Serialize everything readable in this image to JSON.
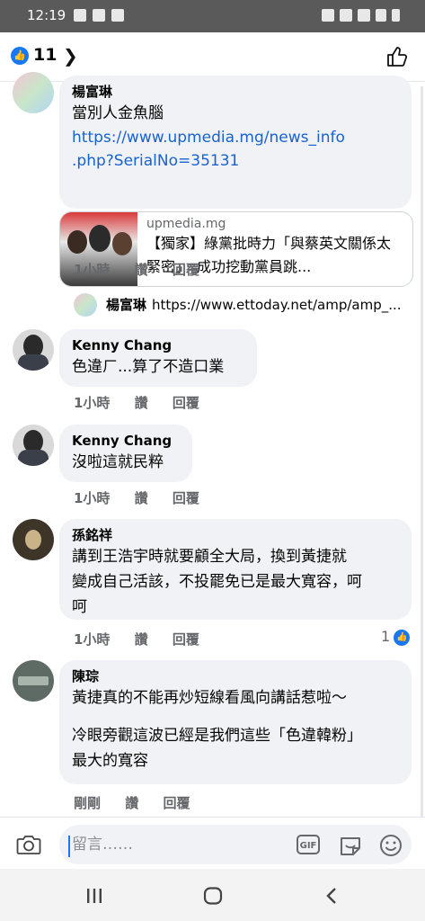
{
  "status_bar": {
    "time": "12:19"
  },
  "header": {
    "like_count": "11"
  },
  "comments": [
    {
      "author": "楊富琳",
      "text": "當別人金魚腦",
      "link_line1": "https://www.upmedia.mg/news_info",
      "link_line2": ".php?SerialNo=35131",
      "preview": {
        "domain": "upmedia.mg",
        "title": "【獨家】綠黨批時力「與蔡英文關係太緊密」　成功挖動黨員跳..."
      },
      "time": "1小時",
      "like_label": "讚",
      "reply_label": "回覆"
    },
    {
      "reply_author": "楊富琳",
      "reply_text": "https://www.ettoday.net/amp/amp_..."
    },
    {
      "author": "Kenny Chang",
      "text": "色違ㄏ...算了不造口業",
      "time": "1小時",
      "like_label": "讚",
      "reply_label": "回覆"
    },
    {
      "author": "Kenny Chang",
      "text": "沒啦這就民粹",
      "time": "1小時",
      "like_label": "讚",
      "reply_label": "回覆"
    },
    {
      "author": "孫銘祥",
      "text_line1": "講到王浩宇時就要顧全大局，換到黃捷就",
      "text_line2": "變成自己活該，不投罷免已是最大寬容，呵",
      "text_line3": "呵",
      "time": "1小時",
      "like_label": "讚",
      "reply_label": "回覆",
      "reaction_count": "1"
    },
    {
      "author": "陳琮",
      "text_line1": "黃捷真的不能再炒短線看風向講話惹啦～",
      "text_line2": "冷眼旁觀這波已經是我們這些「色違韓粉」",
      "text_line3": "最大的寬容",
      "time": "剛剛",
      "like_label": "讚",
      "reply_label": "回覆"
    }
  ],
  "composer": {
    "placeholder": "留言……",
    "gif_label": "GIF"
  },
  "colors": {
    "accent": "#1877f2",
    "bubble": "#f0f2f5",
    "link": "#1763cf",
    "secondary_text": "#65676b"
  }
}
